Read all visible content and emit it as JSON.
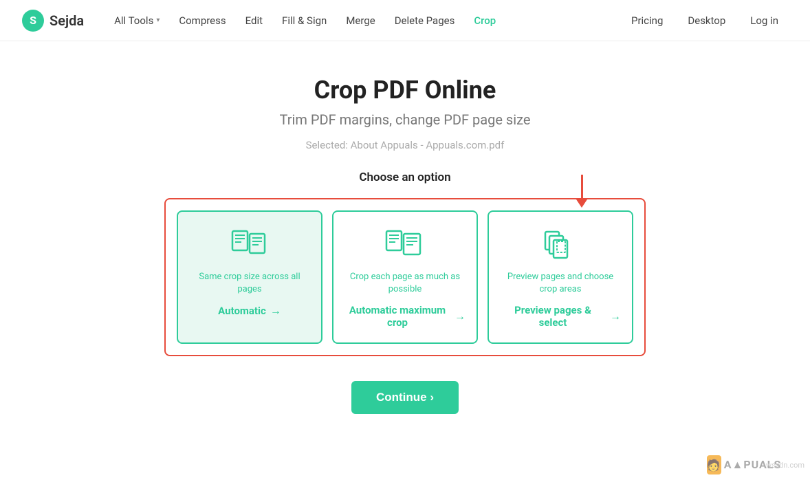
{
  "nav": {
    "logo_letter": "S",
    "logo_name": "Sejda",
    "links": [
      {
        "label": "All Tools",
        "hasChevron": true
      },
      {
        "label": "Compress",
        "hasChevron": false
      },
      {
        "label": "Edit",
        "hasChevron": false
      },
      {
        "label": "Fill & Sign",
        "hasChevron": false
      },
      {
        "label": "Merge",
        "hasChevron": false
      },
      {
        "label": "Delete Pages",
        "hasChevron": false
      },
      {
        "label": "Crop",
        "hasChevron": false,
        "active": true
      }
    ],
    "right_links": [
      {
        "label": "Pricing"
      },
      {
        "label": "Desktop"
      },
      {
        "label": "Log in"
      }
    ]
  },
  "main": {
    "title": "Crop PDF Online",
    "subtitle": "Trim PDF margins, change PDF page size",
    "selected_file": "Selected: About Appuals - Appuals.com.pdf",
    "choose_label": "Choose an option",
    "options": [
      {
        "desc": "Same crop size across all pages",
        "label": "Automatic",
        "selected": true
      },
      {
        "desc": "Crop each page as much as possible",
        "label": "Automatic maximum crop",
        "selected": false
      },
      {
        "desc": "Preview pages and choose crop areas",
        "label": "Preview pages & select",
        "selected": false
      }
    ],
    "continue_label": "Continue ›"
  },
  "watermark": {
    "text": "wsxdn.com"
  }
}
